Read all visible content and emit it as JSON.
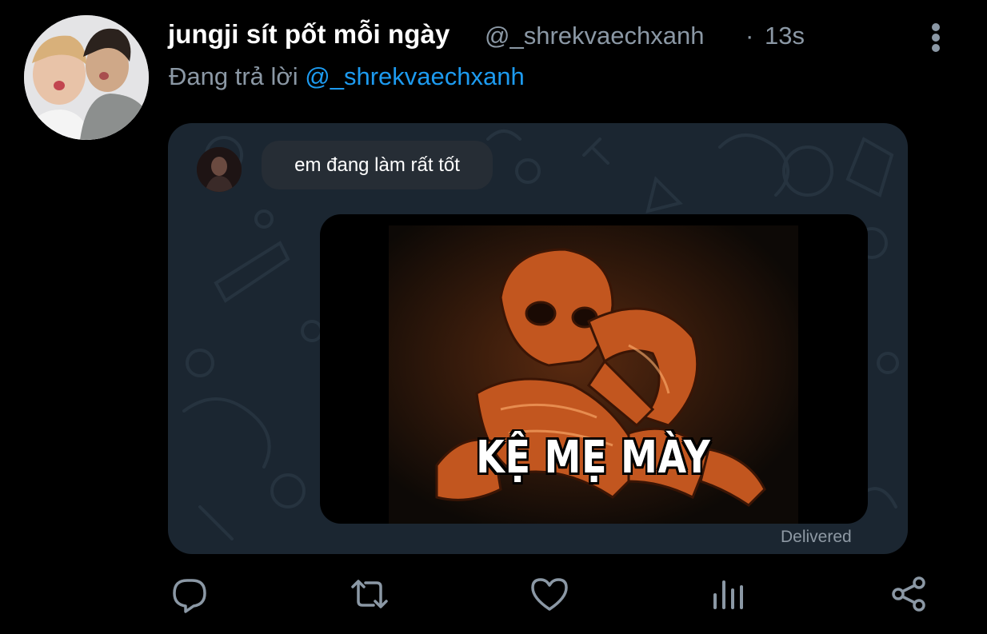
{
  "tweet": {
    "display_name": "jungji sít pốt mỗi ngày",
    "handle": "@_shrekvaechxanh",
    "separator": "·",
    "time": "13s",
    "reply_prefix": "Đang trả lời",
    "reply_mention": "@_shrekvaechxanh"
  },
  "media": {
    "chat_message": "em đang làm rất tốt",
    "meme_caption": "KỆ MẸ MÀY",
    "status": "Delivered"
  },
  "icons": {
    "more": "more-vertical-icon",
    "reply": "reply-icon",
    "retweet": "retweet-icon",
    "like": "heart-icon",
    "stats": "analytics-icon",
    "share": "share-icon"
  },
  "colors": {
    "background": "#000000",
    "name": "#ffffff",
    "muted": "#8b98a5",
    "mention": "#1d9bf0",
    "card_background": "#1b2631"
  }
}
